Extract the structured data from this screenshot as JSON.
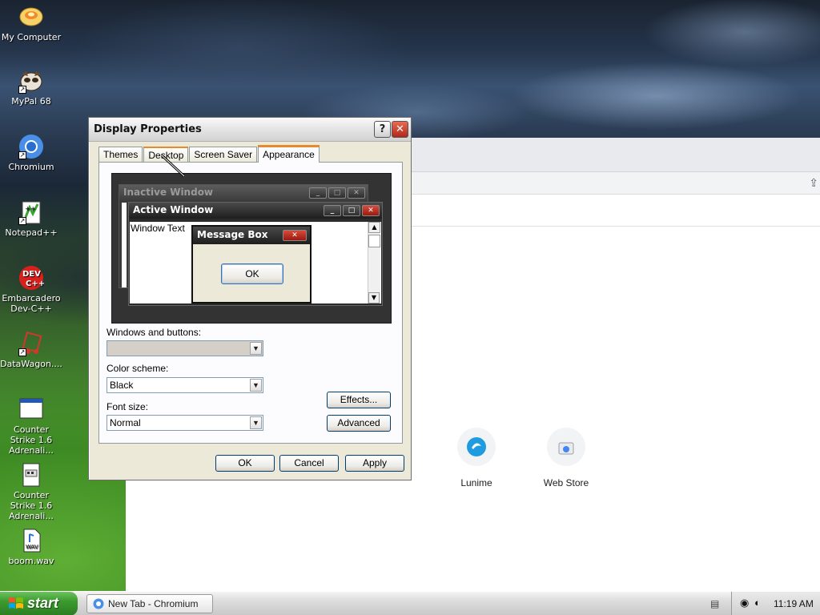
{
  "desktop": {
    "icons": [
      {
        "label": "My Computer",
        "icon": "my-computer-icon"
      },
      {
        "label": "MyPal 68",
        "icon": "mypal-icon"
      },
      {
        "label": "Chromium",
        "icon": "chromium-icon"
      },
      {
        "label": "Notepad++",
        "icon": "notepad-plus-plus-icon"
      },
      {
        "label": "Embarcadero Dev-C++",
        "icon": "devcpp-icon",
        "badge": "DEV\nC++"
      },
      {
        "label": "DataWagon....",
        "icon": "datawagon-icon"
      },
      {
        "label": "Counter Strike 1.6 Adrenali...",
        "icon": "app-window-icon"
      },
      {
        "label": "Counter Strike 1.6 Adrenali...",
        "icon": "app-doc-icon"
      },
      {
        "label": "boom.wav",
        "icon": "wav-file-icon",
        "badge": "WAV"
      }
    ]
  },
  "chromium": {
    "shortcuts": [
      {
        "label": "Lunime",
        "icon": "lunime-icon"
      },
      {
        "label": "Web Store",
        "icon": "web-store-icon"
      }
    ]
  },
  "dialog": {
    "title": "Display Properties",
    "help_glyph": "?",
    "close_glyph": "✕",
    "tabs": [
      {
        "label": "Themes",
        "active": false
      },
      {
        "label": "Desktop",
        "active": false
      },
      {
        "label": "Screen Saver",
        "active": false
      },
      {
        "label": "Appearance",
        "active": true
      }
    ],
    "preview": {
      "inactive_title": "Inactive Window",
      "active_title": "Active Window",
      "window_text": "Window Text",
      "message_title": "Message Box",
      "message_ok": "OK",
      "min_glyph": "_",
      "max_glyph": "□",
      "close_glyph": "✕"
    },
    "windows_buttons": {
      "label": "Windows and buttons:",
      "value": ""
    },
    "color_scheme": {
      "label": "Color scheme:",
      "value": "Black"
    },
    "font_size": {
      "label": "Font size:",
      "value": "Normal"
    },
    "effects_label": "Effects...",
    "advanced_label": "Advanced",
    "ok_label": "OK",
    "cancel_label": "Cancel",
    "apply_label": "Apply"
  },
  "taskbar": {
    "start_label": "start",
    "task_label": "New Tab - Chromium",
    "clock": "11:19 AM"
  },
  "colors": {
    "start_green": "#3b9a2e",
    "tab_highlight": "#e68b2c",
    "close_red": "#b1281a"
  }
}
